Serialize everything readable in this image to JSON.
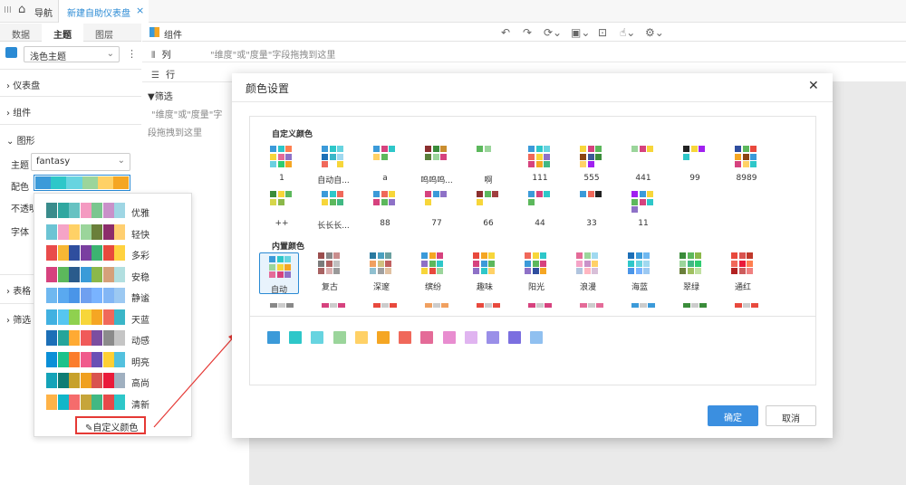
{
  "topbar": {
    "nav_label": "导航",
    "tab_label": "新建自助仪表盘",
    "grip": "III",
    "close": "×"
  },
  "left_tabs": [
    "数据",
    "主题",
    "图层"
  ],
  "theme_select": {
    "value": "浅色主题"
  },
  "sections": [
    "仪表盘",
    "组件",
    "图形",
    "表格",
    "筛选"
  ],
  "graphics": {
    "theme_label": "主题",
    "theme_value": "fantasy",
    "palette_label": "配色",
    "opacity_label": "不透明",
    "font_label": "字体"
  },
  "toolbar": {
    "component_label": "组件"
  },
  "shelves": {
    "columns_label": "列",
    "columns_hint": "\"维度\"或\"度量\"字段拖拽到这里",
    "rows_label": "行",
    "filter_label": "筛选",
    "filter_hint_1": "\"维度\"或\"度量\"字",
    "filter_hint_2": "段拖拽到这里"
  },
  "popup": {
    "schemes": [
      {
        "name": "优雅",
        "colors": [
          "#3a8c8c",
          "#2fa7a0",
          "#67c2c2",
          "#f49ac1",
          "#7bc68f",
          "#c991c9",
          "#9fd6e4"
        ]
      },
      {
        "name": "轻快",
        "colors": [
          "#6cc4d4",
          "#f5a4c7",
          "#ffd166",
          "#9bd59b",
          "#6a7f3a",
          "#8c2d6b",
          "#ffcf70"
        ]
      },
      {
        "name": "多彩",
        "colors": [
          "#e94b4b",
          "#f7b733",
          "#2f4e9e",
          "#7a3fa0",
          "#3cb371",
          "#e8493d",
          "#ffd23f"
        ]
      },
      {
        "name": "安稳",
        "colors": [
          "#d6427e",
          "#5cb85c",
          "#2a5b8c",
          "#3a9bd8",
          "#8bb84a",
          "#d5a07a",
          "#b2dfe0"
        ]
      },
      {
        "name": "静谧",
        "colors": [
          "#6fb8f0",
          "#5aa9f0",
          "#4a95e8",
          "#6fa0f0",
          "#79b3ff",
          "#82b6f5",
          "#9cc9f2"
        ]
      },
      {
        "name": "天蓝",
        "colors": [
          "#41b1e1",
          "#56c6f0",
          "#8fd14f",
          "#f7d63a",
          "#f5a623",
          "#f0685a",
          "#3ab6c8"
        ]
      },
      {
        "name": "动感",
        "colors": [
          "#1c6fb7",
          "#26a59a",
          "#ffaa33",
          "#f05a5a",
          "#7c4ea0",
          "#8b8b8b",
          "#c5c5c5"
        ]
      },
      {
        "name": "明亮",
        "colors": [
          "#0a8fd7",
          "#1cc28b",
          "#fb7d2d",
          "#f05a8c",
          "#6a4fb5",
          "#ffcf33",
          "#53c1de"
        ]
      },
      {
        "name": "高尚",
        "colors": [
          "#14a3b8",
          "#0f7d74",
          "#c7a12b",
          "#f0a020",
          "#d9534f",
          "#ea1a3a",
          "#a0b0c0"
        ]
      },
      {
        "name": "清新",
        "colors": [
          "#ffb347",
          "#12b6c9",
          "#f56c6c",
          "#c6a53a",
          "#41b883",
          "#e64a4a",
          "#2ec7c9"
        ]
      }
    ],
    "custom_label": "自定义颜色"
  },
  "modal": {
    "title": "颜色设置",
    "custom_section_label": "自定义颜色",
    "builtin_section_label": "内置颜色",
    "custom_tiles": [
      {
        "label": "1",
        "colors": [
          "#3b9ad9",
          "#2ec7c9",
          "#ff7f50",
          "#f7d63a",
          "#e46b98",
          "#8e71c7",
          "#6ad0e0",
          "#2ecc71",
          "#f5a623"
        ]
      },
      {
        "label": "自动自...",
        "colors": [
          "#3b9ad9",
          "#2ec7c9",
          "#67d4e0",
          "#1c6fb7",
          "#3ab6c8",
          "#a0d9f0",
          "#f0685a",
          "",
          "#f7d63a"
        ]
      },
      {
        "label": "a",
        "colors": [
          "#3b9ad9",
          "#d6427e",
          "#2ec7c9",
          "#ffd166",
          "#5cb85c",
          "",
          "",
          "",
          ""
        ]
      },
      {
        "label": "呜呜呜...",
        "colors": [
          "#8b2f2f",
          "#3a8c3a",
          "#c98d2f",
          "#5a7f3a",
          "#9bd59b",
          "#d6427e",
          "",
          "",
          ""
        ]
      },
      {
        "label": "啊",
        "colors": [
          "#5cb85c",
          "#9bd59b",
          "",
          "",
          "",
          "",
          "",
          "",
          ""
        ]
      },
      {
        "label": "111",
        "colors": [
          "#3b9ad9",
          "#2ec7c9",
          "#67d4e0",
          "#f0685a",
          "#f7d63a",
          "#8e71c7",
          "#d6427e",
          "#f5a623",
          "#41b883"
        ]
      },
      {
        "label": "555",
        "colors": [
          "#f7d63a",
          "#d6427e",
          "#5cb85c",
          "#8b4513",
          "#3b5998",
          "#3a8c3a",
          "#ffd166",
          "#a020f0",
          ""
        ]
      },
      {
        "label": "441",
        "colors": [
          "#9bd59b",
          "#d6427e",
          "#f7d63a",
          "",
          "",
          "",
          "",
          "",
          ""
        ]
      },
      {
        "label": "99",
        "colors": [
          "#222222",
          "#f7d63a",
          "#a020f0",
          "#2ec7c9",
          "",
          "",
          "",
          "",
          ""
        ]
      },
      {
        "label": "8989",
        "colors": [
          "#2f4e9e",
          "#5cb85c",
          "#e8493d",
          "#f5a623",
          "#8b4513",
          "#3b9ad9",
          "#d6427e",
          "#ffd166",
          "#2ec7c9"
        ]
      },
      {
        "label": "++",
        "colors": [
          "#3a8c3a",
          "#f7d63a",
          "#5cb85c",
          "#d6d64a",
          "#8bb84a",
          "",
          "",
          "",
          ""
        ]
      },
      {
        "label": "长长长...",
        "colors": [
          "#3b9ad9",
          "#2ec7c9",
          "#f0685a",
          "#f7d63a",
          "#5cb85c",
          "#41b883",
          "",
          "",
          ""
        ]
      },
      {
        "label": "88",
        "colors": [
          "#3b9ad9",
          "#f0685a",
          "#f7d63a",
          "#d6427e",
          "#5cb85c",
          "#8e71c7",
          "",
          "",
          ""
        ]
      },
      {
        "label": "77",
        "colors": [
          "#d6427e",
          "#3b9ad9",
          "#8e71c7",
          "#f7d63a",
          "",
          "",
          "",
          "",
          ""
        ]
      },
      {
        "label": "66",
        "colors": [
          "#8b2f2f",
          "#5cb85c",
          "#a04040",
          "#f7d63a",
          "",
          "",
          "",
          "",
          ""
        ]
      },
      {
        "label": "44",
        "colors": [
          "#3b9ad9",
          "#d6427e",
          "#2ec7c9",
          "#5cb85c",
          "",
          "",
          "",
          "",
          ""
        ]
      },
      {
        "label": "33",
        "colors": [
          "#3b9ad9",
          "#f0685a",
          "#222222",
          "",
          "",
          "",
          "",
          "",
          ""
        ]
      },
      {
        "label": "11",
        "colors": [
          "#a020f0",
          "#3b9ad9",
          "#f7d63a",
          "#5cb85c",
          "#d6427e",
          "#2ec7c9",
          "#8e71c7",
          "",
          ""
        ]
      }
    ],
    "builtin_tiles": [
      {
        "label": "自动",
        "colors": [
          "#3b9ad9",
          "#2ec7c9",
          "#67d4e0",
          "#9bd59b",
          "#f7d63a",
          "#f5a623",
          "#e46b98",
          "#d6427e",
          "#8e71c7"
        ]
      },
      {
        "label": "复古",
        "colors": [
          "#9b4e4e",
          "#888888",
          "#c98d8d",
          "#7b7b7b",
          "#b06060",
          "#c0c0c0",
          "#a86262",
          "#d9b0b0",
          "#999999"
        ]
      },
      {
        "label": "深邃",
        "colors": [
          "#2a7aa0",
          "#4aa0c0",
          "#6aa0a0",
          "#f0a060",
          "#d0c080",
          "#c06060",
          "#90c0d0",
          "#a0a0a0",
          "#e0c0a0"
        ]
      },
      {
        "label": "缤纷",
        "colors": [
          "#3b9ad9",
          "#f5a623",
          "#d6427e",
          "#8e71c7",
          "#5cb85c",
          "#2ec7c9",
          "#f7d63a",
          "#e8493d",
          "#9bd59b"
        ]
      },
      {
        "label": "趣味",
        "colors": [
          "#e8493d",
          "#f5a623",
          "#f7d63a",
          "#d6427e",
          "#3b9ad9",
          "#5cb85c",
          "#8e71c7",
          "#2ec7c9",
          "#ffd166"
        ]
      },
      {
        "label": "阳光",
        "colors": [
          "#f0685a",
          "#f7d63a",
          "#2ec7c9",
          "#3b9ad9",
          "#5cb85c",
          "#d6427e",
          "#8e71c7",
          "#2f4e9e",
          "#f5a623"
        ]
      },
      {
        "label": "浪漫",
        "colors": [
          "#e46b98",
          "#9bd59b",
          "#a0d9f0",
          "#f5a4c7",
          "#c991c9",
          "#ffd166",
          "#b0c4de",
          "#ffb6c1",
          "#d8bfd8"
        ]
      },
      {
        "label": "海蓝",
        "colors": [
          "#1c6fb7",
          "#3b9ad9",
          "#6fb8f0",
          "#2ec7c9",
          "#67d4e0",
          "#a0d9f0",
          "#4a95e8",
          "#79b3ff",
          "#9cc9f2"
        ]
      },
      {
        "label": "翠绿",
        "colors": [
          "#3a8c3a",
          "#5cb85c",
          "#8bb84a",
          "#9bd59b",
          "#41b883",
          "#2ecc71",
          "#6a7f3a",
          "#a0c060",
          "#c0e0a0"
        ]
      },
      {
        "label": "通红",
        "colors": [
          "#e8493d",
          "#d9534f",
          "#c0392b",
          "#f0685a",
          "#ea1a3a",
          "#ff7f50",
          "#b22222",
          "#cd5c5c",
          "#f08080"
        ]
      }
    ],
    "partial_row_colors": [
      "#888888",
      "#d6427e",
      "#e8493d",
      "#f0a060",
      "#e8493d",
      "#d6427e",
      "#e46b98",
      "#3b9ad9",
      "#3a8c3a",
      "#e8493d"
    ],
    "selected_palette": [
      "#3b9ad9",
      "#2ec7c9",
      "#67d4e0",
      "#9bd59b",
      "#ffd166",
      "#f5a623",
      "#f0685a",
      "#e46b98",
      "#e88dd0",
      "#e0b4f0",
      "#9a8fe8",
      "#7b6fe0",
      "#90c0f0"
    ],
    "ok_label": "确定",
    "cancel_label": "取消"
  },
  "colors": {
    "accent": "#2a8ad4",
    "ok_button": "#3b8fe0",
    "highlight_border": "#e53935"
  }
}
